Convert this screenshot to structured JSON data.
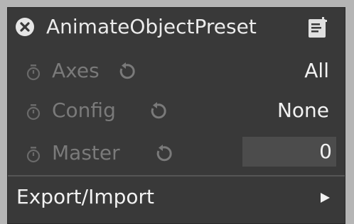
{
  "panel": {
    "title": "AnimateObjectPreset",
    "close_icon": "close-circle-icon",
    "preset_icon": "preset-document-icon"
  },
  "rows": [
    {
      "label": "Axes",
      "value": "All"
    },
    {
      "label": "Config",
      "value": "None"
    },
    {
      "label": "Master",
      "value": "0"
    }
  ],
  "export": {
    "label": "Export/Import",
    "arrow_icon": "submenu-arrow-icon"
  },
  "colors": {
    "panel_bg": "#393939",
    "outer_bg": "#b5b5b5",
    "label_disabled": "#7a7a7a",
    "text": "#f2f2f2",
    "field_bg": "#4c4c4c"
  }
}
